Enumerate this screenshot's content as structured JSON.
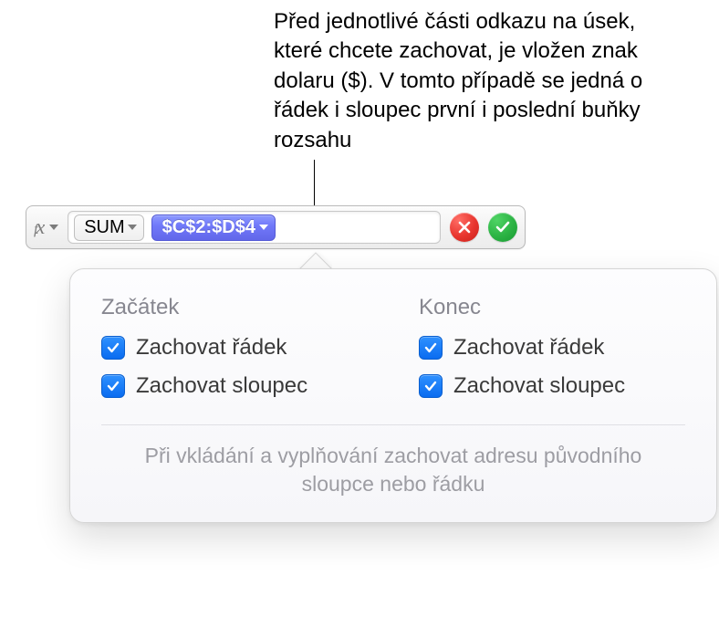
{
  "annotation": "Před jednotlivé části odkazu na úsek, které chcete zachovat, je vložen znak dolaru ($). V tomto případě se jedná o řádek i sloupec první i poslední buňky rozsahu",
  "formula_bar": {
    "fx_label": "fx",
    "function_name": "SUM",
    "reference": "$C$2:$D$4"
  },
  "popover": {
    "start": {
      "heading": "Začátek",
      "row_label": "Zachovat řádek",
      "col_label": "Zachovat sloupec",
      "row_checked": true,
      "col_checked": true
    },
    "end": {
      "heading": "Konec",
      "row_label": "Zachovat řádek",
      "col_label": "Zachovat sloupec",
      "row_checked": true,
      "col_checked": true
    },
    "hint": "Při vkládání a vyplňování zachovat adresu původního sloupce nebo řádku"
  }
}
